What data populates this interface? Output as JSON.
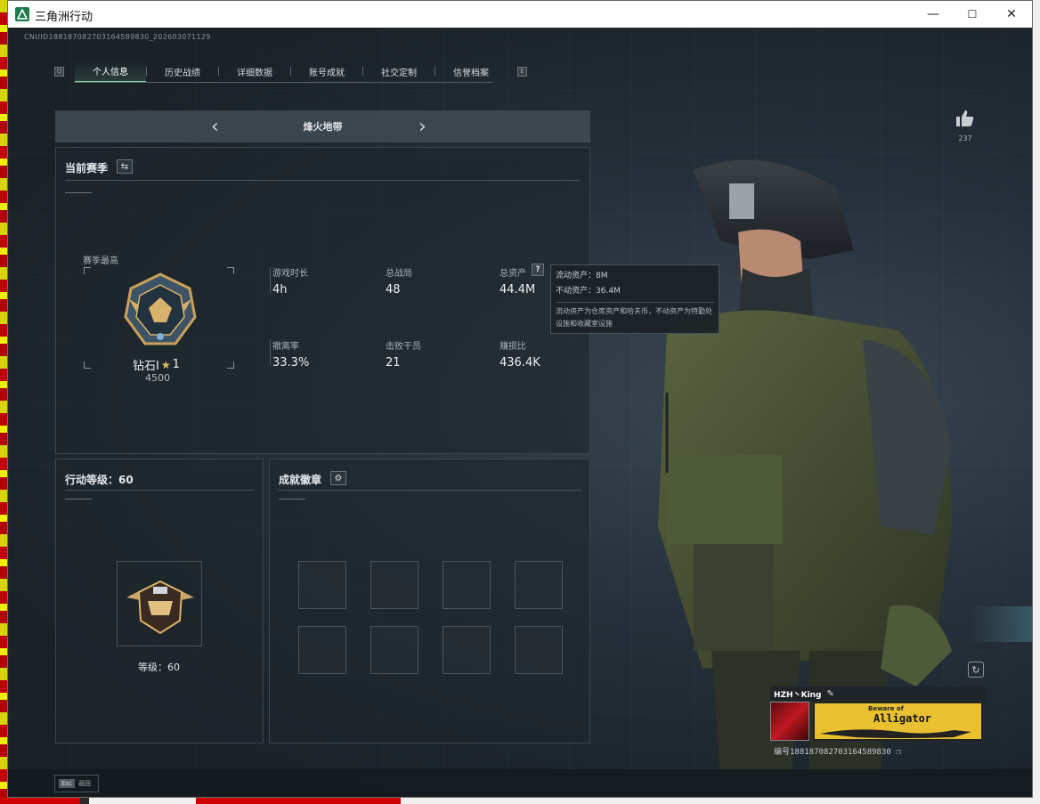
{
  "window": {
    "title": "三角洲行动",
    "controls": {
      "minimize": "—",
      "maximize": "☐",
      "close": "✕"
    }
  },
  "cnuid": "CNUID188187082703164589830_202603071129",
  "tabs": {
    "left_key": "Q",
    "right_key": "E",
    "items": [
      "个人信息",
      "历史战绩",
      "详细数据",
      "账号成就",
      "社交定制",
      "信誉档案"
    ],
    "active_index": 0
  },
  "mode": {
    "label": "烽火地带"
  },
  "season": {
    "title": "当前赛季",
    "highest_label": "赛季最高",
    "rank_name": "钻石I",
    "rank_stars": "1",
    "rank_score": "4500",
    "stats": [
      {
        "label": "游戏时长",
        "value": "4h"
      },
      {
        "label": "总战局",
        "value": "48"
      },
      {
        "label": "总资产",
        "value": "44.4M"
      },
      {
        "label": "撤离率",
        "value": "33.3%"
      },
      {
        "label": "击败干员",
        "value": "21"
      },
      {
        "label": "赚损比",
        "value": "436.4K"
      }
    ]
  },
  "tooltip": {
    "liquid": "流动资产：8M",
    "fixed": "不动资产：36.4M",
    "note": "流动资产为仓库资产和哈夫币，不动资产为特勤处设施和收藏室设施"
  },
  "level": {
    "title": "行动等级：60",
    "label": "等级：60"
  },
  "badges": {
    "title": "成就徽章",
    "count": 8
  },
  "like": {
    "count": "237"
  },
  "profile": {
    "name": "HZH丶King",
    "banner_small": "Beware of",
    "banner_big": "Alligator",
    "uid": "编号188187082703164589830"
  },
  "footer": {
    "esc_key": "Esc",
    "esc_label": "返回"
  },
  "colors": {
    "accent": "#7fd6a4",
    "panel": "#1e262c",
    "background": "#1a2127"
  },
  "icons": {
    "like": "thumbs-up-icon",
    "swap": "swap-icon",
    "settings": "gear-icon",
    "help": "question-icon",
    "edit": "pencil-icon",
    "copy": "copy-icon",
    "refresh": "refresh-icon"
  }
}
